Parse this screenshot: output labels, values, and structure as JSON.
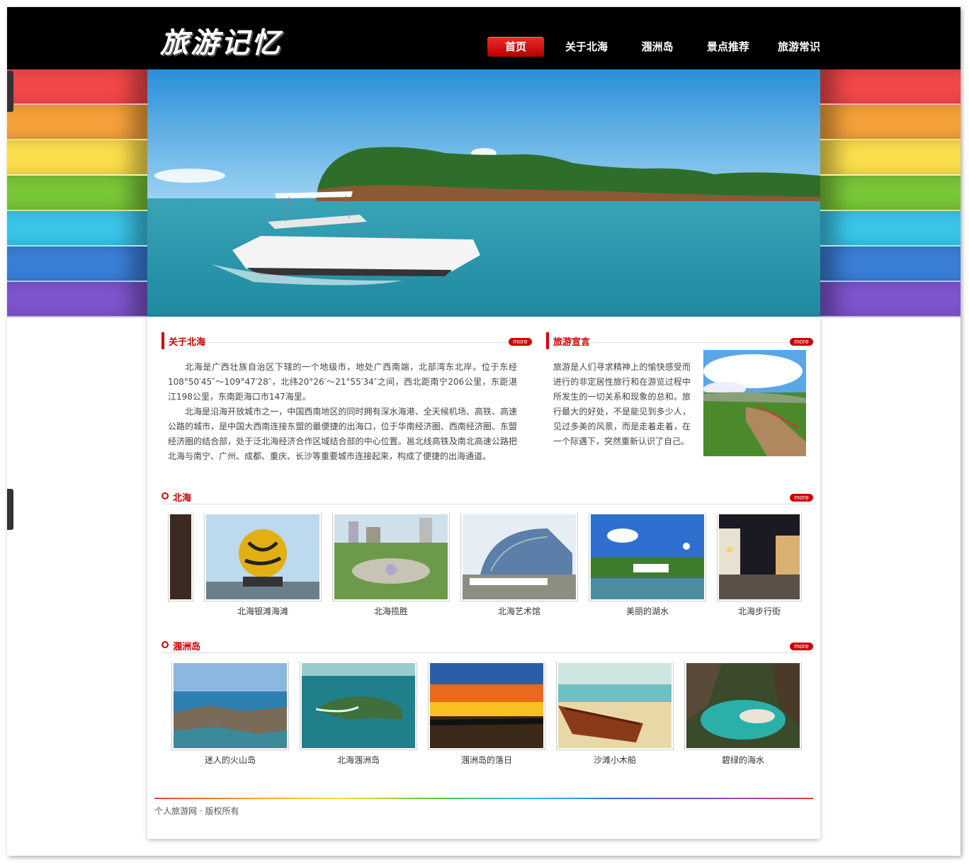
{
  "site": {
    "logo": "旅游记忆"
  },
  "nav": {
    "items": [
      {
        "label": "首页",
        "active": true
      },
      {
        "label": "关于北海",
        "active": false
      },
      {
        "label": "涠洲岛",
        "active": false
      },
      {
        "label": "景点推荐",
        "active": false
      },
      {
        "label": "旅游常识",
        "active": false
      }
    ]
  },
  "stripe_colors": [
    "#f4484a",
    "#f6a23b",
    "#fde04d",
    "#79c838",
    "#3ac6ea",
    "#3a7fd9",
    "#7f55cf"
  ],
  "about": {
    "title": "关于北海",
    "more": "more",
    "p1": "北海是广西壮族自治区下辖的一个地级市，地处广西南端，北部湾东北岸。位于东经108°50′45″～109°47′28″，北纬20°26′～21°55′34″之间，西北距南宁206公里，东距湛江198公里，东南距海口市147海里。",
    "p2": "北海是沿海开放城市之一，中国西南地区的同时拥有深水海港、全天候机场、高铁、高速公路的城市，是中国大西南连接东盟的最便捷的出海口，位于华南经济圈、西南经济圈、东盟经济圈的结合部，处于泛北海经济合作区域结合部的中心位置。邕北线高铁及南北高速公路把北海与南宁、广州、成都、重庆、长沙等重要城市连接起来，构成了便捷的出海通道。"
  },
  "manifesto": {
    "title": "旅游宣言",
    "more": "more",
    "text": "旅游是人们寻求精神上的愉快感受而进行的非定居性旅行和在游览过程中所发生的一切关系和现象的总和。旅行最大的好处，不是能见到多少人，见过多美的风景，而是走着走着，在一个际遇下，突然重新认识了自己。"
  },
  "beihai": {
    "title": "北海",
    "more": "more",
    "items": [
      {
        "caption": "北海银滩海滩"
      },
      {
        "caption": "北海揽胜"
      },
      {
        "caption": "北海艺术馆"
      },
      {
        "caption": "美丽的湖水"
      },
      {
        "caption": "北海步行街"
      }
    ]
  },
  "weizhou": {
    "title": "涠洲岛",
    "more": "more",
    "items": [
      {
        "caption": "迷人的火山岛"
      },
      {
        "caption": "北海涠洲岛"
      },
      {
        "caption": "涠洲岛的落日"
      },
      {
        "caption": "沙滩小木船"
      },
      {
        "caption": "碧绿的海水"
      }
    ]
  },
  "footer": {
    "text": "个人旅游网 · 版权所有"
  }
}
